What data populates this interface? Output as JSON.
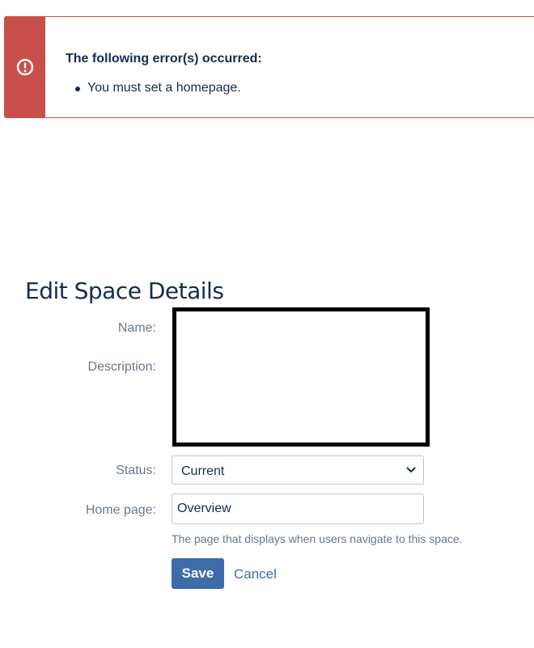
{
  "error": {
    "title": "The following error(s) occurred:",
    "messages": [
      "You must set a homepage."
    ],
    "accent_color": "#c9504a",
    "icon": "exclamation-circle-icon"
  },
  "form": {
    "title": "Edit Space Details",
    "name_label": "Name:",
    "description_label": "Description:",
    "status_label": "Status:",
    "status_value": "Current",
    "homepage_label": "Home page:",
    "homepage_value": "Overview",
    "homepage_help": "The page that displays when users navigate to this space.",
    "save_label": "Save",
    "cancel_label": "Cancel",
    "primary_color": "#3d6ca8"
  }
}
